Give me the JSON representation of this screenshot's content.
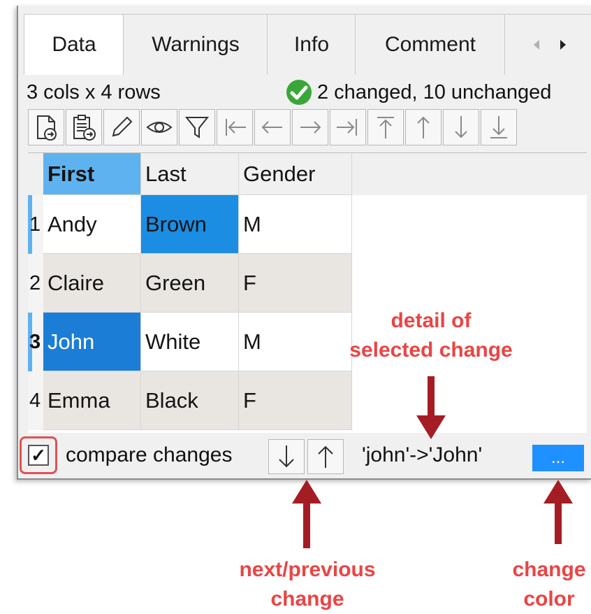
{
  "tabs": [
    {
      "label": "Data",
      "active": true
    },
    {
      "label": "Warnings",
      "active": false
    },
    {
      "label": "Info",
      "active": false
    },
    {
      "label": "Comment",
      "active": false
    }
  ],
  "info": {
    "dimensions": "3 cols x 4 rows",
    "status": "2 changed, 10 unchanged"
  },
  "toolbar_icons": [
    "insert-file-icon",
    "paste-icon",
    "edit-pencil-icon",
    "view-eye-icon",
    "filter-icon",
    "first-column-icon",
    "left-arrow-icon",
    "right-arrow-icon",
    "last-column-icon",
    "top-row-icon",
    "up-arrow-icon",
    "down-arrow-icon",
    "bottom-row-icon"
  ],
  "table": {
    "columns": [
      "First",
      "Last",
      "Gender"
    ],
    "rows": [
      {
        "num": "1",
        "cells": [
          "Andy",
          "Brown",
          "M"
        ]
      },
      {
        "num": "2",
        "cells": [
          "Claire",
          "Green",
          "F"
        ]
      },
      {
        "num": "3",
        "cells": [
          "John",
          "White",
          "M"
        ]
      },
      {
        "num": "4",
        "cells": [
          "Emma",
          "Black",
          "F"
        ]
      }
    ]
  },
  "bottom": {
    "checkbox_checked": true,
    "checkbox_mark": "✓",
    "compare_label": "compare changes",
    "change_detail": "'john'->'John'",
    "color_button_label": "..."
  },
  "annotations": {
    "detail": [
      "detail of",
      "selected change"
    ],
    "nav": [
      "next/previous",
      "change"
    ],
    "color": [
      "change",
      "color"
    ]
  },
  "colors": {
    "changed_cell": "#1b8de3",
    "selected_cell": "#1b7dd6",
    "selected_header": "#5eb2f0",
    "annotation": "#e84545",
    "arrow": "#a51d24"
  }
}
